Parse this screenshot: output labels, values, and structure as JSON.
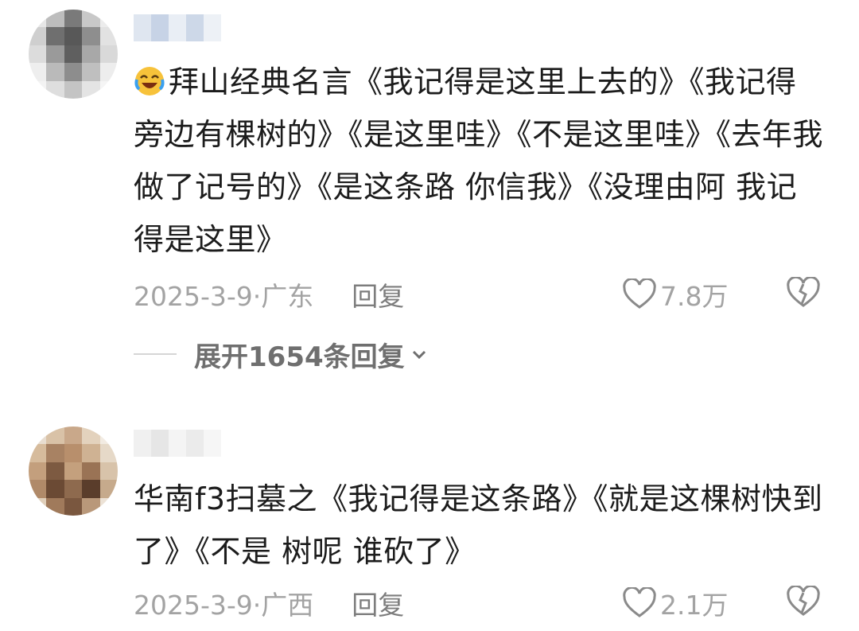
{
  "comments": [
    {
      "text": "拜山经典名言《我记得是这里上去的》《我记得旁边有棵树的》《是这里哇》《不是这里哇》《去年我做了记号的》《是这条路 你信我》《没理由阿 我记得是这里》",
      "date": "2025-3-9·",
      "location": "广东",
      "reply_label": "回复",
      "likes": "7.8万",
      "expand_label": "展开1654条回复"
    },
    {
      "text": "华南f3扫墓之《我记得是这条路》《就是这棵树快到了》《不是 树呢 谁砍了》",
      "date": "2025-3-9·",
      "location": "广西",
      "reply_label": "回复",
      "likes": "2.1万"
    }
  ],
  "icons": {
    "emoji": "laughing-crying-emoji-icon",
    "like": "heart-outline-icon",
    "dislike": "broken-heart-icon",
    "expand": "chevron-down-icon"
  },
  "colors": {
    "meta": "#a3a3a3",
    "text": "#1c1c1c",
    "expand": "#6f6f6f"
  }
}
